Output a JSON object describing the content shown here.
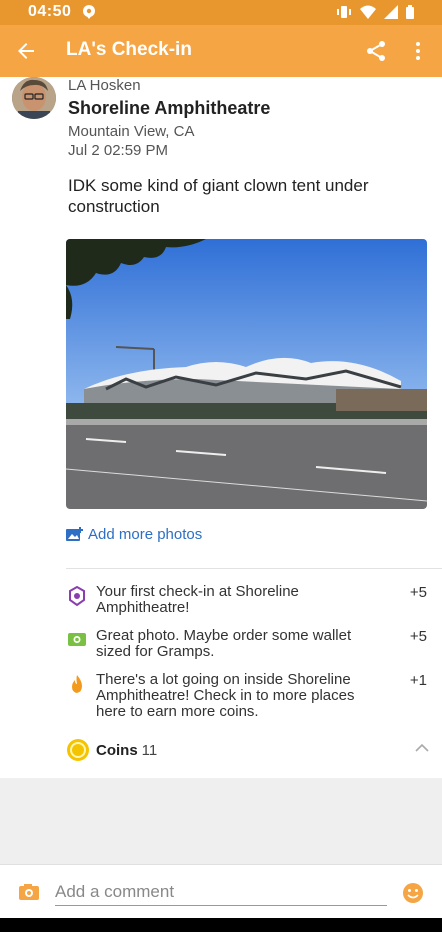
{
  "status_bar": {
    "time": "04:50"
  },
  "app_bar": {
    "title": "LA's Check-in"
  },
  "checkin": {
    "user_name": "LA Hosken",
    "venue": "Shoreline Amphitheatre",
    "city": "Mountain View, CA",
    "date": "Jul 2 02:59 PM",
    "shout": "IDK some kind of giant clown tent under construction"
  },
  "add_photos_label": "Add more photos",
  "rewards": [
    {
      "icon": "first-checkin-icon",
      "text": "Your first check-in at Shoreline Amphitheatre!",
      "points": "+5"
    },
    {
      "icon": "photo-reward-icon",
      "text": "Great photo. Maybe order some wallet sized for Gramps.",
      "points": "+5"
    },
    {
      "icon": "flame-icon",
      "text": "There's a lot going on inside Shoreline Amphitheatre! Check in to more places here to earn more coins.",
      "points": "+1"
    }
  ],
  "coins": {
    "label": "Coins",
    "count": "11"
  },
  "comment": {
    "placeholder": "Add a comment"
  },
  "colors": {
    "app_bar": "#f5a543",
    "status_bar": "#e8972f",
    "link": "#2d6fc4",
    "coin": "#f5c400"
  }
}
